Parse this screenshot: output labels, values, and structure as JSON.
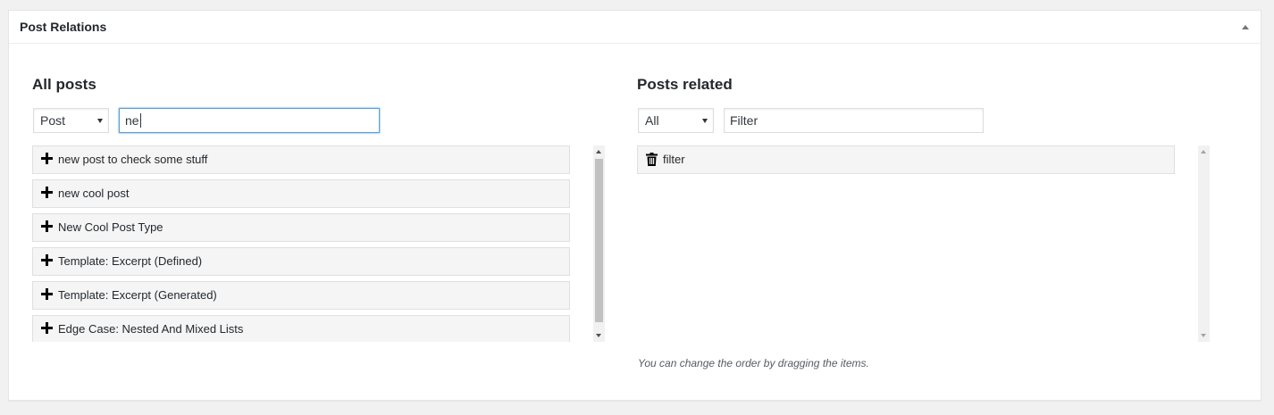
{
  "metabox": {
    "title": "Post Relations"
  },
  "all_posts": {
    "heading": "All posts",
    "type_select": {
      "selected": "Post"
    },
    "search": {
      "value": "ne"
    },
    "items": [
      {
        "label": "new post to check some stuff",
        "icon": "plus-icon"
      },
      {
        "label": "new cool post",
        "icon": "plus-icon"
      },
      {
        "label": "New Cool Post Type",
        "icon": "plus-icon"
      },
      {
        "label": "Template: Excerpt (Defined)",
        "icon": "plus-icon"
      },
      {
        "label": "Template: Excerpt (Generated)",
        "icon": "plus-icon"
      },
      {
        "label": "Edge Case: Nested And Mixed Lists",
        "icon": "plus-icon"
      }
    ]
  },
  "posts_related": {
    "heading": "Posts related",
    "type_select": {
      "selected": "All"
    },
    "filter": {
      "value": "Filter"
    },
    "items": [
      {
        "label": "filter",
        "icon": "trash-icon"
      }
    ],
    "hint": "You can change the order by dragging the items."
  },
  "colors": {
    "focus_border": "#5b9dd9",
    "item_background": "#f5f5f5",
    "page_background": "#f1f1f1"
  }
}
